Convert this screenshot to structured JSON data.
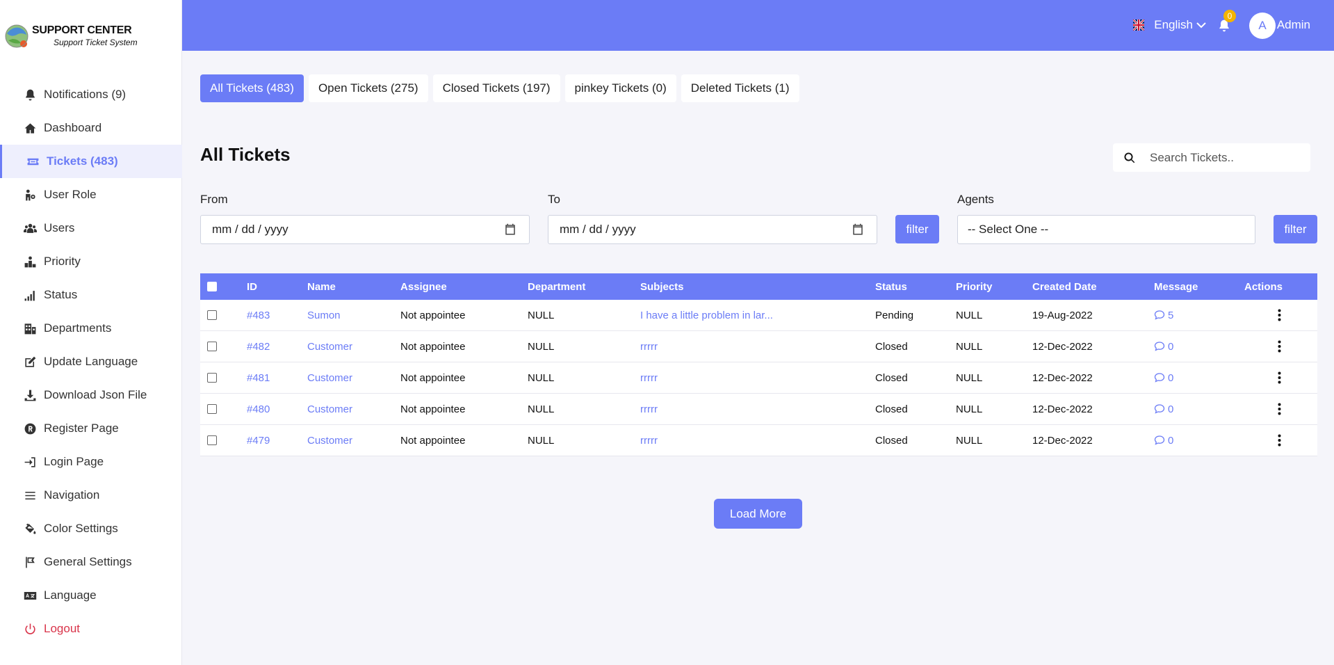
{
  "brand": {
    "title": "SUPPORT CENTER",
    "subtitle": "Support Ticket System",
    "accent": "#6b7cf6",
    "danger": "#d9344a",
    "badge": "#f4b400"
  },
  "sidebar": {
    "items": [
      {
        "key": "notifications",
        "label": "Notifications (9)",
        "icon": "bell-icon"
      },
      {
        "key": "dashboard",
        "label": "Dashboard",
        "icon": "home-icon"
      },
      {
        "key": "tickets",
        "label": "Tickets (483)",
        "icon": "ticket-icon",
        "active": true
      },
      {
        "key": "user-role",
        "label": "User Role",
        "icon": "user-role-icon"
      },
      {
        "key": "users",
        "label": "Users",
        "icon": "users-icon"
      },
      {
        "key": "priority",
        "label": "Priority",
        "icon": "priority-icon"
      },
      {
        "key": "status",
        "label": "Status",
        "icon": "signal-icon"
      },
      {
        "key": "departments",
        "label": "Departments",
        "icon": "building-icon"
      },
      {
        "key": "update-language",
        "label": "Update Language",
        "icon": "edit-icon"
      },
      {
        "key": "download-json",
        "label": "Download Json File",
        "icon": "download-icon"
      },
      {
        "key": "register-page",
        "label": "Register Page",
        "icon": "registered-icon"
      },
      {
        "key": "login-page",
        "label": "Login Page",
        "icon": "login-icon"
      },
      {
        "key": "navigation",
        "label": "Navigation",
        "icon": "menu-icon"
      },
      {
        "key": "color-settings",
        "label": "Color Settings",
        "icon": "paint-bucket-icon"
      },
      {
        "key": "general-settings",
        "label": "General Settings",
        "icon": "flag-icon"
      },
      {
        "key": "language",
        "label": "Language",
        "icon": "language-icon"
      },
      {
        "key": "logout",
        "label": "Logout",
        "icon": "power-icon",
        "danger": true
      }
    ]
  },
  "header": {
    "language": "English",
    "notification_count": "0",
    "avatar_initial": "A",
    "user_name": "Admin"
  },
  "tabs": [
    {
      "label": "All Tickets (483)",
      "active": true
    },
    {
      "label": "Open Tickets (275)"
    },
    {
      "label": "Closed Tickets (197)"
    },
    {
      "label": "pinkey Tickets (0)"
    },
    {
      "label": "Deleted Tickets (1)"
    }
  ],
  "page": {
    "title": "All Tickets",
    "search_placeholder": "Search Tickets.."
  },
  "filters": {
    "from_label": "From",
    "from_placeholder": "mm / dd / yyyy",
    "to_label": "To",
    "to_placeholder": "mm / dd / yyyy",
    "filter_label": "filter",
    "agents_label": "Agents",
    "agents_selected": "-- Select One --"
  },
  "table": {
    "columns": [
      "ID",
      "Name",
      "Assignee",
      "Department",
      "Subjects",
      "Status",
      "Priority",
      "Created Date",
      "Message",
      "Actions"
    ],
    "rows": [
      {
        "id": "#483",
        "name": "Sumon",
        "assignee": "Not appointee",
        "department": "NULL",
        "subject": "I have a little problem in lar...",
        "status": "Pending",
        "priority": "NULL",
        "created": "19-Aug-2022",
        "messages": "5"
      },
      {
        "id": "#482",
        "name": "Customer",
        "assignee": "Not appointee",
        "department": "NULL",
        "subject": "rrrrr",
        "status": "Closed",
        "priority": "NULL",
        "created": "12-Dec-2022",
        "messages": "0"
      },
      {
        "id": "#481",
        "name": "Customer",
        "assignee": "Not appointee",
        "department": "NULL",
        "subject": "rrrrr",
        "status": "Closed",
        "priority": "NULL",
        "created": "12-Dec-2022",
        "messages": "0"
      },
      {
        "id": "#480",
        "name": "Customer",
        "assignee": "Not appointee",
        "department": "NULL",
        "subject": "rrrrr",
        "status": "Closed",
        "priority": "NULL",
        "created": "12-Dec-2022",
        "messages": "0"
      },
      {
        "id": "#479",
        "name": "Customer",
        "assignee": "Not appointee",
        "department": "NULL",
        "subject": "rrrrr",
        "status": "Closed",
        "priority": "NULL",
        "created": "12-Dec-2022",
        "messages": "0"
      }
    ]
  },
  "load_more_label": "Load More"
}
